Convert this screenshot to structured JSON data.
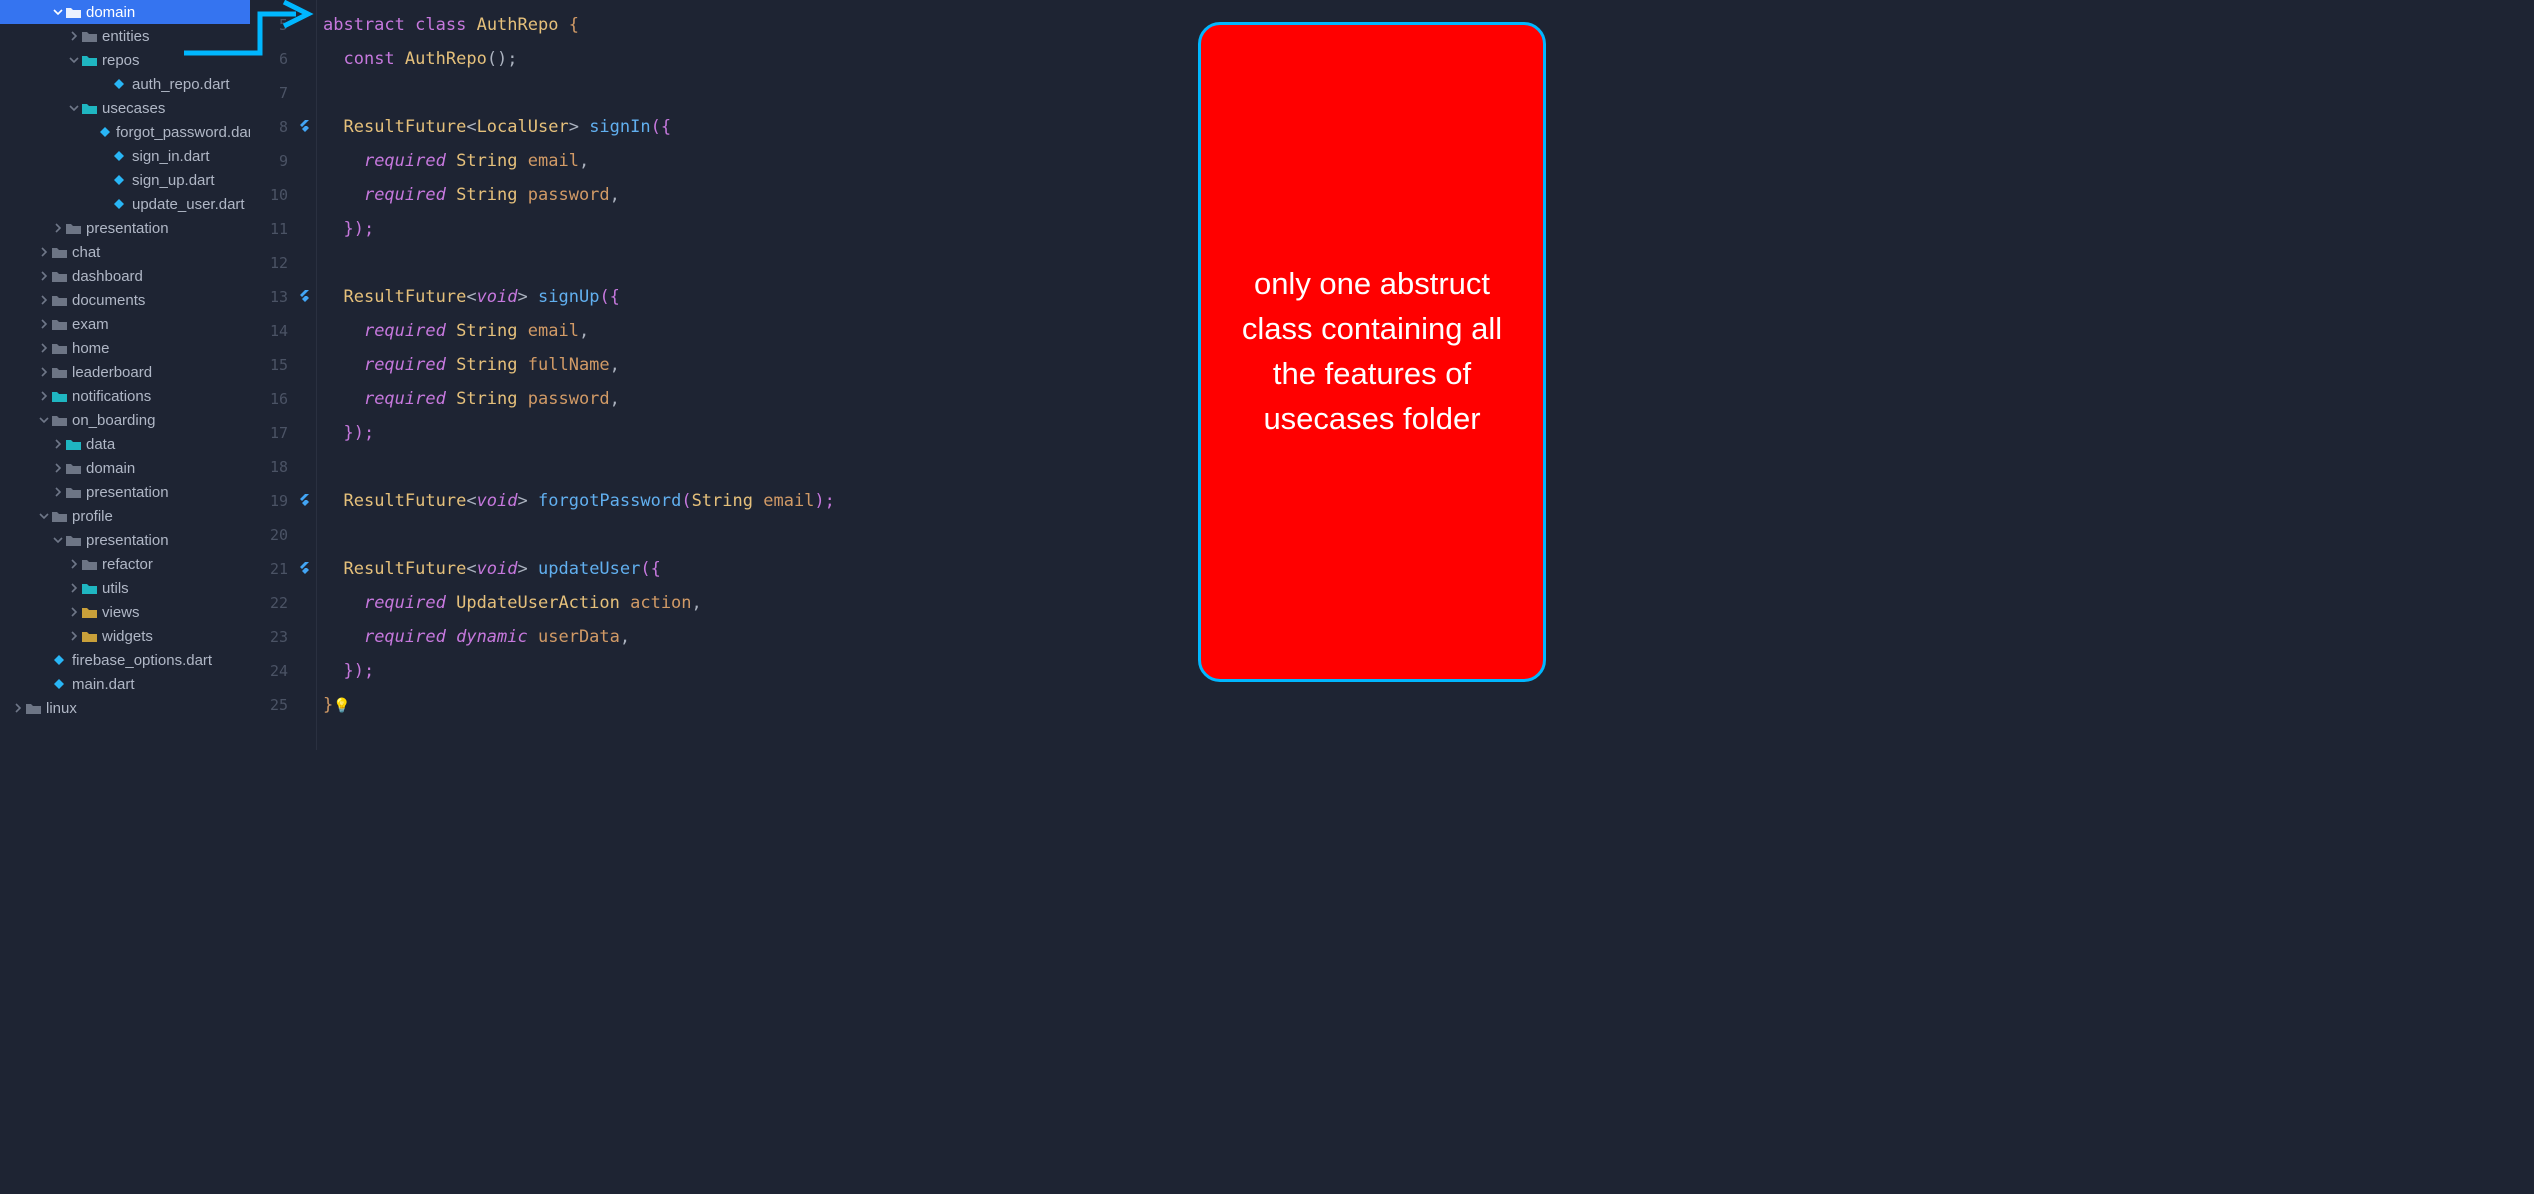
{
  "sidebar": {
    "items": [
      {
        "indent": 52,
        "chev": "down",
        "icon": "folder-open",
        "iconColor": "#c6ccd7",
        "label": "domain",
        "selected": true
      },
      {
        "indent": 68,
        "chev": "right",
        "icon": "folder",
        "label": "entities"
      },
      {
        "indent": 68,
        "chev": "down",
        "icon": "folder-cyan",
        "label": "repos"
      },
      {
        "indent": 98,
        "chev": "",
        "icon": "dart",
        "label": "auth_repo.dart"
      },
      {
        "indent": 68,
        "chev": "down",
        "icon": "folder-cyan",
        "label": "usecases"
      },
      {
        "indent": 98,
        "chev": "",
        "icon": "dart",
        "label": "forgot_password.dart"
      },
      {
        "indent": 98,
        "chev": "",
        "icon": "dart",
        "label": "sign_in.dart"
      },
      {
        "indent": 98,
        "chev": "",
        "icon": "dart",
        "label": "sign_up.dart"
      },
      {
        "indent": 98,
        "chev": "",
        "icon": "dart",
        "label": "update_user.dart"
      },
      {
        "indent": 52,
        "chev": "right",
        "icon": "folder",
        "label": "presentation"
      },
      {
        "indent": 38,
        "chev": "right",
        "icon": "folder",
        "label": "chat"
      },
      {
        "indent": 38,
        "chev": "right",
        "icon": "folder",
        "label": "dashboard"
      },
      {
        "indent": 38,
        "chev": "right",
        "icon": "folder",
        "label": "documents"
      },
      {
        "indent": 38,
        "chev": "right",
        "icon": "folder",
        "label": "exam"
      },
      {
        "indent": 38,
        "chev": "right",
        "icon": "folder",
        "label": "home"
      },
      {
        "indent": 38,
        "chev": "right",
        "icon": "folder",
        "label": "leaderboard"
      },
      {
        "indent": 38,
        "chev": "right",
        "icon": "folder-cyan",
        "label": "notifications"
      },
      {
        "indent": 38,
        "chev": "down",
        "icon": "folder",
        "label": "on_boarding"
      },
      {
        "indent": 52,
        "chev": "right",
        "icon": "folder-cyan",
        "label": "data"
      },
      {
        "indent": 52,
        "chev": "right",
        "icon": "folder",
        "label": "domain"
      },
      {
        "indent": 52,
        "chev": "right",
        "icon": "folder",
        "label": "presentation"
      },
      {
        "indent": 38,
        "chev": "down",
        "icon": "folder",
        "label": "profile"
      },
      {
        "indent": 52,
        "chev": "down",
        "icon": "folder",
        "label": "presentation"
      },
      {
        "indent": 68,
        "chev": "right",
        "icon": "folder",
        "label": "refactor"
      },
      {
        "indent": 68,
        "chev": "right",
        "icon": "folder-cyan",
        "label": "utils"
      },
      {
        "indent": 68,
        "chev": "right",
        "icon": "folder-yellow",
        "label": "views"
      },
      {
        "indent": 68,
        "chev": "right",
        "icon": "folder-yellow",
        "label": "widgets"
      },
      {
        "indent": 38,
        "chev": "",
        "icon": "dart",
        "label": "firebase_options.dart"
      },
      {
        "indent": 38,
        "chev": "",
        "icon": "dart",
        "label": "main.dart"
      },
      {
        "indent": 12,
        "chev": "right",
        "icon": "folder",
        "label": "linux"
      }
    ]
  },
  "gutter": {
    "start": 5,
    "lines": [
      "5",
      "6",
      "7",
      "8",
      "9",
      "10",
      "11",
      "12",
      "13",
      "14",
      "15",
      "16",
      "17",
      "18",
      "19",
      "20",
      "21",
      "22",
      "23",
      "24",
      "25"
    ],
    "icons": {
      "8": "flutter",
      "13": "flutter",
      "19": "flutter",
      "21": "flutter"
    }
  },
  "code": {
    "l5": {
      "t1": "abstract",
      "t2": "class",
      "t3": "AuthRepo",
      "t4": "{"
    },
    "l6": {
      "t1": "const",
      "t2": "AuthRepo",
      "t3": "();"
    },
    "l8": {
      "t1": "ResultFuture",
      "t2": "LocalUser",
      "t3": "signIn",
      "t4": "({"
    },
    "l9": {
      "t1": "required",
      "t2": "String",
      "t3": "email",
      "t4": ","
    },
    "l10": {
      "t1": "required",
      "t2": "String",
      "t3": "password",
      "t4": ","
    },
    "l11": {
      "t1": "});"
    },
    "l13": {
      "t1": "ResultFuture",
      "t2": "void",
      "t3": "signUp",
      "t4": "({"
    },
    "l14": {
      "t1": "required",
      "t2": "String",
      "t3": "email",
      "t4": ","
    },
    "l15": {
      "t1": "required",
      "t2": "String",
      "t3": "fullName",
      "t4": ","
    },
    "l16": {
      "t1": "required",
      "t2": "String",
      "t3": "password",
      "t4": ","
    },
    "l17": {
      "t1": "});"
    },
    "l19": {
      "t1": "ResultFuture",
      "t2": "void",
      "t3": "forgotPassword",
      "t4": "(",
      "t5": "String",
      "t6": "email",
      "t7": ");"
    },
    "l21": {
      "t1": "ResultFuture",
      "t2": "void",
      "t3": "updateUser",
      "t4": "({"
    },
    "l22": {
      "t1": "required",
      "t2": "UpdateUserAction",
      "t3": "action",
      "t4": ","
    },
    "l23": {
      "t1": "required",
      "t2": "dynamic",
      "t3": "userData",
      "t4": ","
    },
    "l24": {
      "t1": "});"
    },
    "l25": {
      "t1": "}"
    }
  },
  "callout": {
    "text": "only one abstruct class containing all the features of usecases folder"
  }
}
